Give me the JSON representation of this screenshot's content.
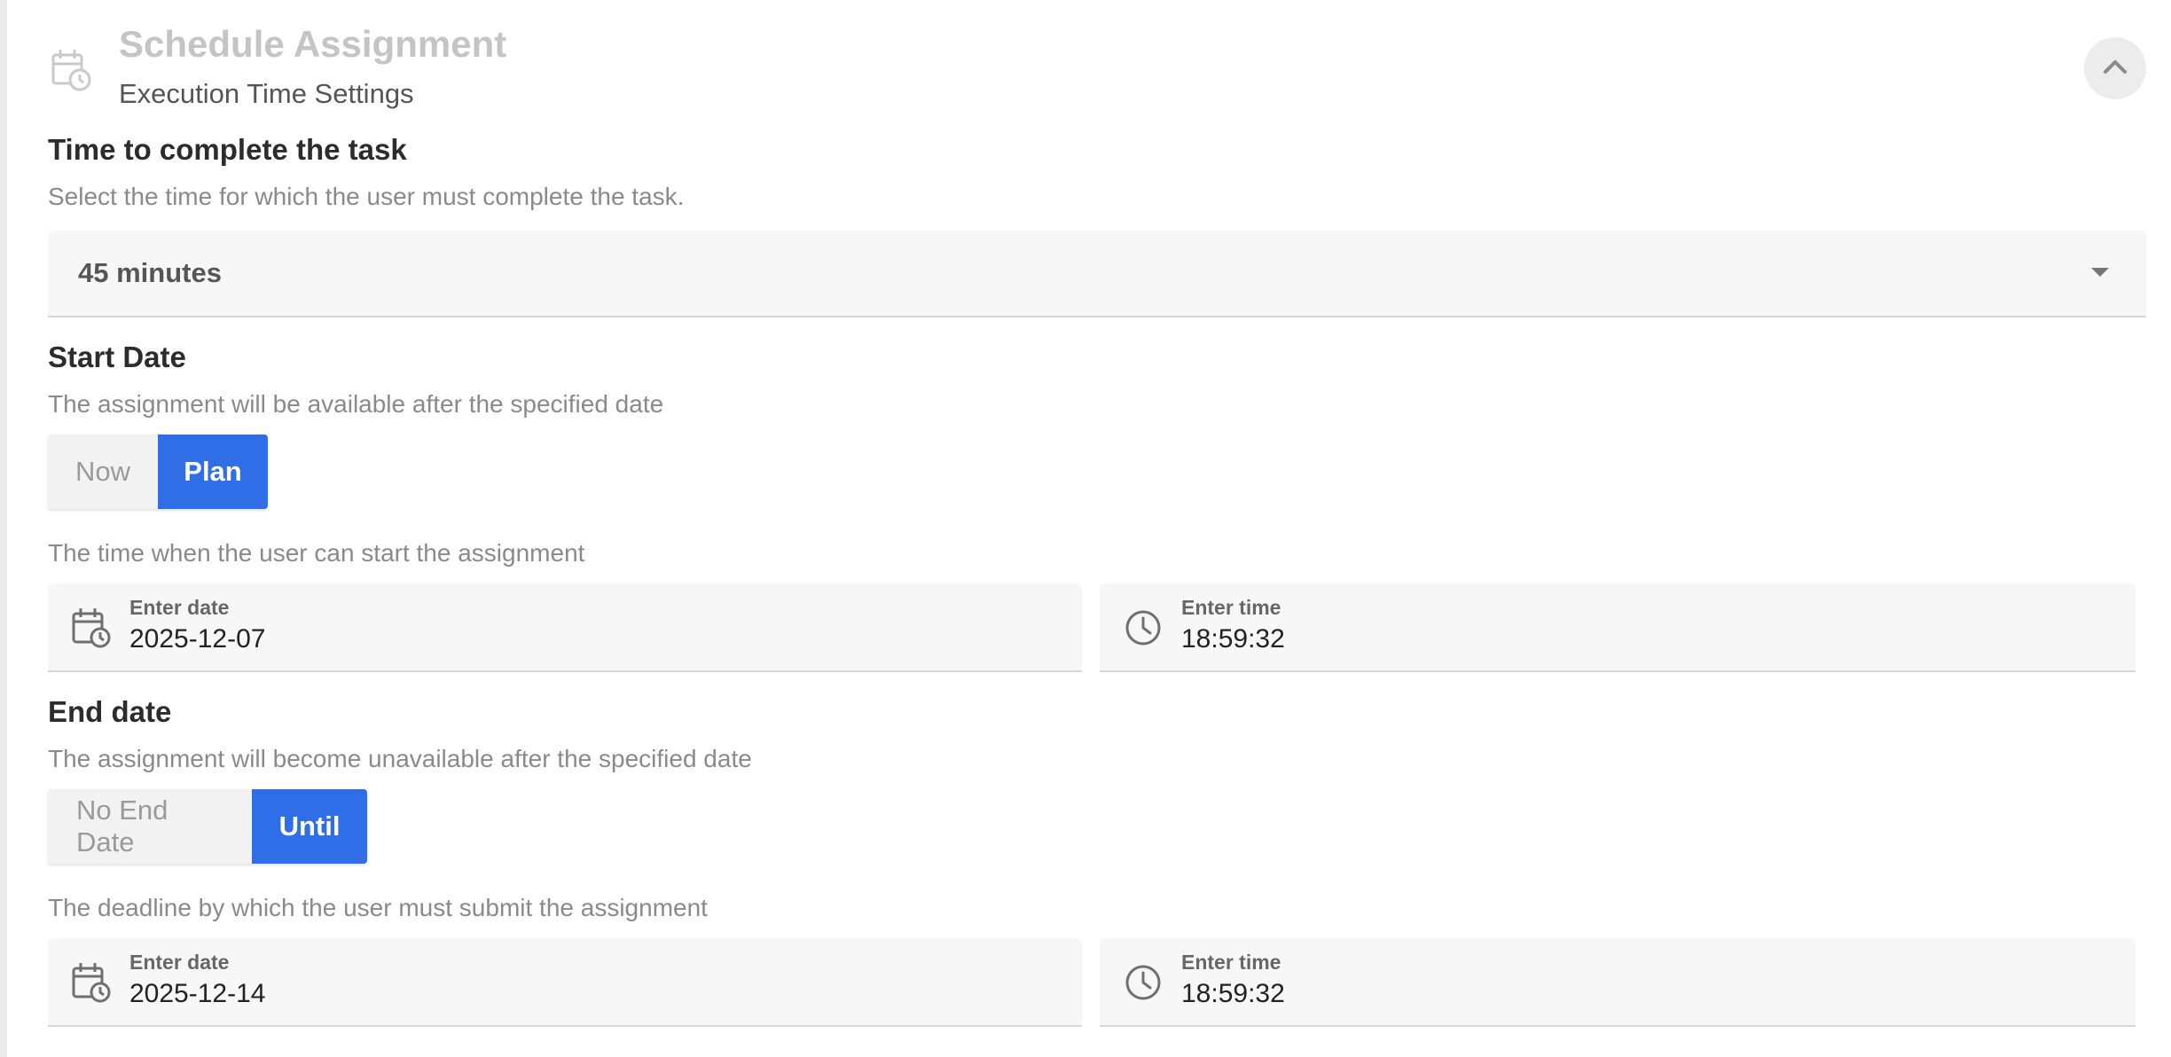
{
  "header": {
    "title": "Schedule Assignment",
    "subtitle": "Execution Time Settings",
    "icon": "calendar-clock-icon",
    "collapse_icon": "chevron-up-icon"
  },
  "time_to_complete": {
    "title": "Time to complete the task",
    "description": "Select the time for which the user must complete the task.",
    "selected": "45 minutes"
  },
  "start_date": {
    "title": "Start Date",
    "description": "The assignment will be available after the specified date",
    "options": [
      "Now",
      "Plan"
    ],
    "selected": "Plan",
    "helper": "The time when the user can start the assignment",
    "date_label": "Enter date",
    "date_value": "2025-12-07",
    "time_label": "Enter time",
    "time_value": "18:59:32"
  },
  "end_date": {
    "title": "End date",
    "description": "The assignment will become unavailable after the specified date",
    "options": [
      "No End Date",
      "Until"
    ],
    "selected": "Until",
    "helper": "The deadline by which the user must submit the assignment",
    "date_label": "Enter date",
    "date_value": "2025-12-14",
    "time_label": "Enter time",
    "time_value": "18:59:32"
  },
  "colors": {
    "accent": "#2f6ee6",
    "title_muted": "#c4c4c4",
    "field_bg": "#f7f7f7"
  }
}
